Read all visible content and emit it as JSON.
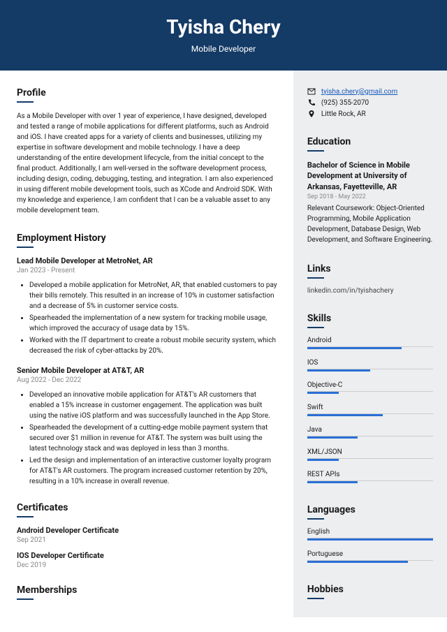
{
  "header": {
    "name": "Tyisha Chery",
    "job_title": "Mobile Developer"
  },
  "profile": {
    "heading": "Profile",
    "text": "As a Mobile Developer with over 1 year of experience, I have designed, developed and tested a range of mobile applications for different platforms, such as Android and iOS. I have created apps for a variety of clients and businesses, utilizing my expertise in software development and mobile technology. I have a deep understanding of the entire development lifecycle, from the initial concept to the final product. Additionally, I am well-versed in the software development process, including design, coding, debugging, testing, and integration. I am also experienced in using different mobile development tools, such as XCode and Android SDK. With my knowledge and experience, I am confident that I can be a valuable asset to any mobile development team."
  },
  "employment": {
    "heading": "Employment History",
    "jobs": [
      {
        "title": "Lead Mobile Developer at MetroNet, AR",
        "dates": "Jan 2023 - Present",
        "bullets": [
          "Developed a mobile application for MetroNet, AR, that enabled customers to pay their bills remotely. This resulted in an increase of 10% in customer satisfaction and a decrease of 5% in customer service costs.",
          "Spearheaded the implementation of a new system for tracking mobile usage, which improved the accuracy of usage data by 15%.",
          "Worked with the IT department to create a robust mobile security system, which decreased the risk of cyber-attacks by 20%."
        ]
      },
      {
        "title": "Senior Mobile Developer at AT&T, AR",
        "dates": "Aug 2022 - Dec 2022",
        "bullets": [
          "Developed an innovative mobile application for AT&T's AR customers that enabled a 15% increase in customer engagement. The application was built using the native iOS platform and was successfully launched in the App Store.",
          "Spearheaded the development of a cutting-edge mobile payment system that secured over $1 million in revenue for AT&T. The system was built using the latest technology stack and was deployed in less than 3 months.",
          "Led the design and implementation of an interactive customer loyalty program for AT&T's AR customers. The program increased customer retention by 20%, resulting in a 10% increase in overall revenue."
        ]
      }
    ]
  },
  "certificates": {
    "heading": "Certificates",
    "items": [
      {
        "title": "Android Developer Certificate",
        "date": "Sep 2021"
      },
      {
        "title": "IOS Developer Certificate",
        "date": "Dec 2019"
      }
    ]
  },
  "memberships": {
    "heading": "Memberships"
  },
  "contact": {
    "email": "tyisha.chery@gmail.com",
    "phone": "(925) 355-2070",
    "location": "Little Rock, AR"
  },
  "education": {
    "heading": "Education",
    "degree": "Bachelor of Science in Mobile Development at University of Arkansas, Fayetteville, AR",
    "dates": "Sep 2018 - May 2022",
    "desc": "Relevant Coursework: Object-Oriented Programming, Mobile Application Development, Database Design, Web Development, and Software Engineering."
  },
  "links": {
    "heading": "Links",
    "items": [
      "linkedin.com/in/tyishachery"
    ]
  },
  "skills": {
    "heading": "Skills",
    "items": [
      {
        "name": "Android",
        "level": 75
      },
      {
        "name": "IOS",
        "level": 50
      },
      {
        "name": "Objective-C",
        "level": 25
      },
      {
        "name": "Swift",
        "level": 60
      },
      {
        "name": "Java",
        "level": 40
      },
      {
        "name": "XML/JSON",
        "level": 25
      },
      {
        "name": "REST APIs",
        "level": 40
      }
    ]
  },
  "languages": {
    "heading": "Languages",
    "items": [
      {
        "name": "English",
        "level": 100
      },
      {
        "name": "Portuguese",
        "level": 80
      }
    ]
  },
  "hobbies": {
    "heading": "Hobbies"
  }
}
